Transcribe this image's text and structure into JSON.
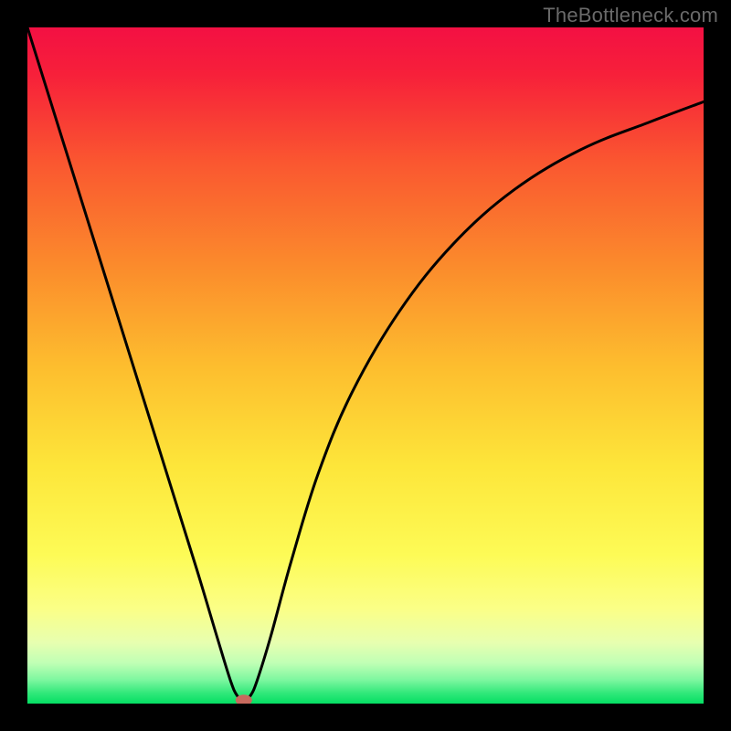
{
  "watermark": "TheBottleneck.com",
  "chart_data": {
    "type": "line",
    "title": "",
    "xlabel": "",
    "ylabel": "",
    "xlim": [
      0,
      100
    ],
    "ylim": [
      0,
      100
    ],
    "gradient_stops": [
      {
        "offset": 0,
        "color": "#f31043"
      },
      {
        "offset": 0.07,
        "color": "#f7203a"
      },
      {
        "offset": 0.2,
        "color": "#fa5730"
      },
      {
        "offset": 0.35,
        "color": "#fb8a2c"
      },
      {
        "offset": 0.5,
        "color": "#fdbd2e"
      },
      {
        "offset": 0.65,
        "color": "#fde63a"
      },
      {
        "offset": 0.78,
        "color": "#fdfb56"
      },
      {
        "offset": 0.86,
        "color": "#fbff87"
      },
      {
        "offset": 0.91,
        "color": "#e7ffb0"
      },
      {
        "offset": 0.94,
        "color": "#c0ffb5"
      },
      {
        "offset": 0.965,
        "color": "#7df79f"
      },
      {
        "offset": 0.985,
        "color": "#2fe879"
      },
      {
        "offset": 1.0,
        "color": "#05df63"
      }
    ],
    "series": [
      {
        "name": "bottleneck-curve",
        "x": [
          0,
          5,
          10,
          15,
          20,
          25,
          28,
          30,
          31,
          32,
          33,
          34,
          36,
          39,
          43,
          48,
          55,
          63,
          72,
          82,
          92,
          100
        ],
        "values": [
          100,
          84,
          68,
          52,
          36,
          20,
          10,
          3.5,
          1.2,
          0.5,
          1.2,
          3.5,
          10,
          21,
          34,
          46,
          58,
          68,
          76,
          82,
          86,
          89
        ]
      }
    ],
    "marker": {
      "x": 32,
      "y": 0.5,
      "color": "#c86a5e",
      "rx": 9,
      "ry": 6
    }
  }
}
